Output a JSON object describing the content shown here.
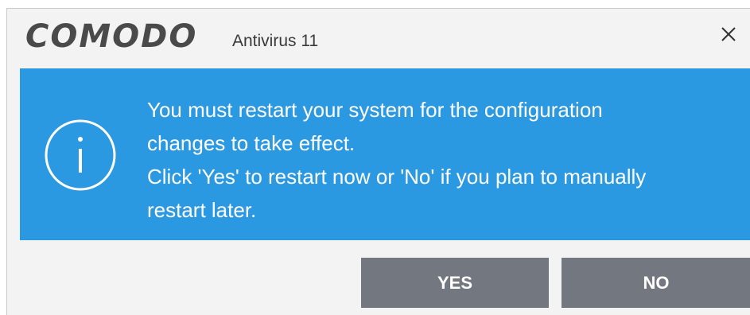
{
  "window": {
    "brand": "COMODO",
    "product": "Antivirus 11",
    "close_icon": "close-icon"
  },
  "banner": {
    "icon": "info-icon",
    "color": "#2b99e2",
    "lines": [
      "You must restart your system for the configuration",
      "changes to take effect.",
      "Click 'Yes' to restart now or 'No' if you plan to manually",
      "restart later."
    ]
  },
  "buttons": {
    "yes_label": "YES",
    "no_label": "NO",
    "color": "#737780"
  }
}
